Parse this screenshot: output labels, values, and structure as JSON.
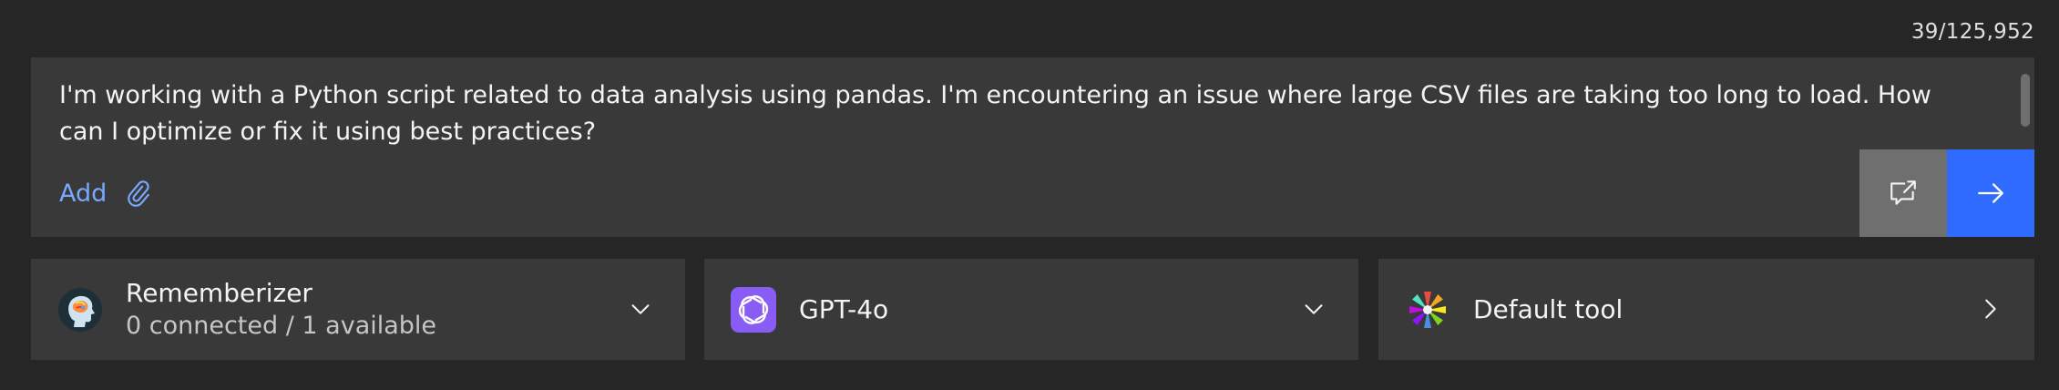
{
  "composer": {
    "char_counter": "39/125,952",
    "prompt_text": "I'm working with a Python script related to data analysis using pandas. I'm encountering an issue where large CSV files are taking too long to load. How can I optimize or fix it using best practices?",
    "add_label": "Add",
    "add_icon": "paperclip-icon",
    "share_icon": "share-chat-icon",
    "send_icon": "arrow-right-icon",
    "send_button_color": "#2f6bff",
    "share_button_color": "#6f6f6f"
  },
  "selectors": {
    "rememberizer": {
      "title": "Rememberizer",
      "subtitle": "0 connected / 1 available",
      "icon": "rememberizer-head-icon",
      "chevron": "chevron-down-icon"
    },
    "model": {
      "title": "GPT-4o",
      "icon": "openai-logo-icon",
      "icon_bg": "#8a5cf6",
      "chevron": "chevron-down-icon"
    },
    "tool": {
      "title": "Default tool",
      "icon": "default-tool-flower-icon",
      "chevron": "chevron-right-icon"
    }
  },
  "colors": {
    "background": "#262626",
    "panel": "#393939",
    "link": "#78a9ff"
  }
}
